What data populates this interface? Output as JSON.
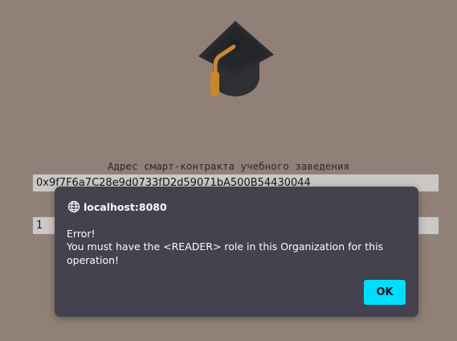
{
  "page": {
    "logo_icon": "graduation-cap-icon",
    "address_label": "Адрес смарт-контракта учебного заведения",
    "address_value": "0x9f7F6a7C28e9d0733fD2d59071bA500B54430044",
    "number_value": "1"
  },
  "dialog": {
    "origin": "localhost:8080",
    "origin_icon": "globe-icon",
    "message_line1": "Error!",
    "message_line2": "You must have the <READER> role in this Organization for this operation!",
    "ok_label": "OK"
  },
  "colors": {
    "page_background": "#918077",
    "dialog_background": "#43424e",
    "ok_button": "#00ddff",
    "cap_dark": "#27282b",
    "tassel": "#c7872b"
  }
}
